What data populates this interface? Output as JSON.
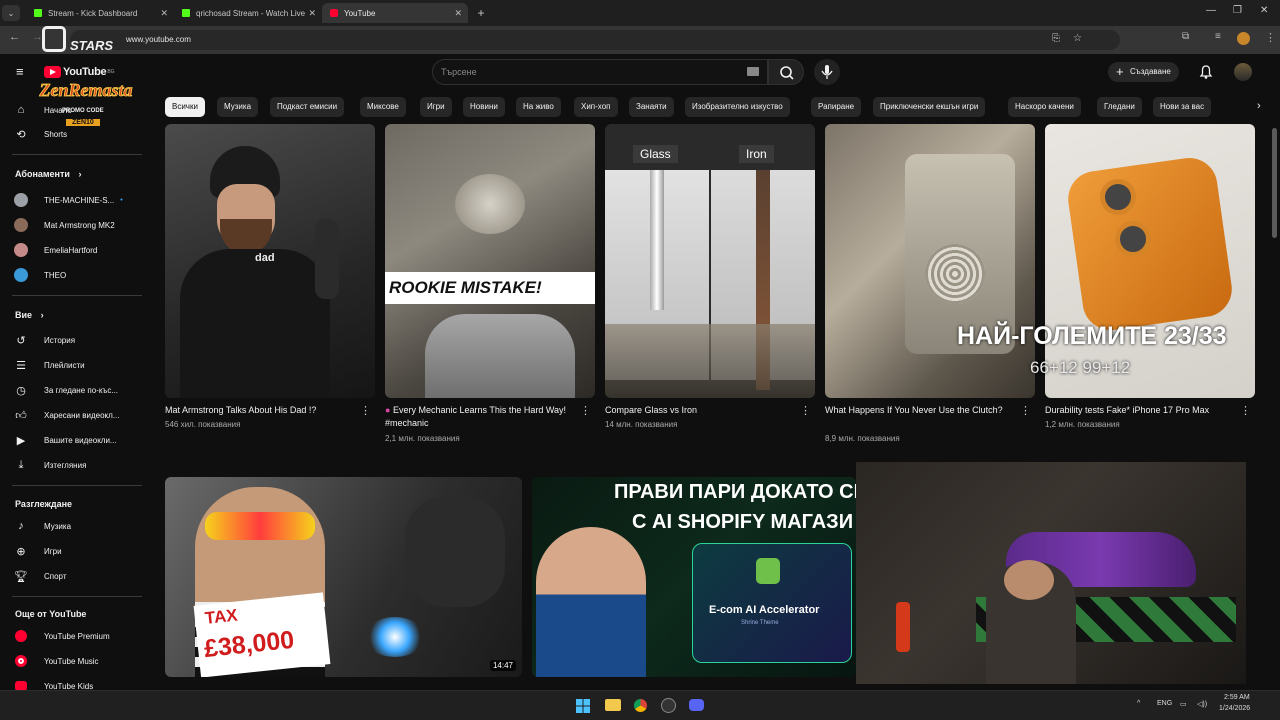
{
  "browser": {
    "tabs": [
      {
        "label": "Stream - Kick Dashboard",
        "icon": "kick-icon"
      },
      {
        "label": "qrichosad Stream - Watch Live",
        "icon": "kick-icon"
      },
      {
        "label": "YouTube",
        "icon": "youtube-icon"
      }
    ],
    "url": "www.youtube.com"
  },
  "overlay": {
    "stars": "STARS",
    "promo_label": "PROMO CODE",
    "promo_code": "ZEN10"
  },
  "header": {
    "logo_text": "YouTube",
    "logo_region": "BG",
    "search_placeholder": "Търсене",
    "create_label": "Създаване"
  },
  "sidebar": {
    "top": [
      {
        "label": "Начало",
        "icon": "home-icon"
      },
      {
        "label": "Shorts",
        "icon": "shorts-icon"
      }
    ],
    "subs_heading": "Абонаменти",
    "subs": [
      {
        "label": "THE-MACHINE-S...",
        "color": "#9aa0a6"
      },
      {
        "label": "Mat Armstrong MK2",
        "color": "#8a6b5a"
      },
      {
        "label": "EmeliaHartford",
        "color": "#c48a8a"
      },
      {
        "label": "THEO",
        "color": "#3a9ad9"
      }
    ],
    "you_heading": "Вие",
    "you": [
      {
        "label": "История",
        "icon": "history-icon"
      },
      {
        "label": "Плейлисти",
        "icon": "playlist-icon"
      },
      {
        "label": "За гледане по-къс...",
        "icon": "clock-icon"
      },
      {
        "label": "Харесани видеокл...",
        "icon": "like-icon"
      },
      {
        "label": "Вашите видеокли...",
        "icon": "video-icon"
      },
      {
        "label": "Изтегляния",
        "icon": "download-icon"
      }
    ],
    "explore_heading": "Разглеждане",
    "explore": [
      {
        "label": "Музика",
        "icon": "music-icon"
      },
      {
        "label": "Игри",
        "icon": "gamepad-icon"
      },
      {
        "label": "Спорт",
        "icon": "trophy-icon"
      }
    ],
    "more_heading": "Още от YouTube",
    "more": [
      {
        "label": "YouTube Premium"
      },
      {
        "label": "YouTube Music"
      },
      {
        "label": "YouTube Kids"
      }
    ]
  },
  "chips": [
    "Всички",
    "Музика",
    "Подкаст емисии",
    "Миксове",
    "Игри",
    "Новини",
    "На живо",
    "Хип-хоп",
    "Занаяти",
    "Изобразително изкуство",
    "Рапиране",
    "Приключенски екшън игри",
    "Наскоро качени",
    "Гледани",
    "Нови за вас"
  ],
  "videos_row1": [
    {
      "title": "Mat Armstrong Talks About His Dad !?",
      "meta": "546 хил. показвания"
    },
    {
      "title": "Every Mechanic Learns This the Hard Way! #mechanic",
      "meta": "2,1 млн. показвания",
      "overlay": "ROOKIE MISTAKE!"
    },
    {
      "title": "Compare Glass vs Iron",
      "meta": "14 млн. показвания",
      "label_left": "Glass",
      "label_right": "Iron"
    },
    {
      "title": "What Happens If You Never Use the Clutch?",
      "meta": "8,9 млн. показвания"
    },
    {
      "title": "Durability tests Fake* iPhone 17 Pro Max",
      "meta": "1,2 млн. показвания"
    }
  ],
  "shirt_text": "dad",
  "stream_overlay": {
    "line1": "НАЙ-ГОЛЕМИТЕ 23/33",
    "line2": "66+12 99+12"
  },
  "videos_row2": [
    {
      "duration": "14:47",
      "tax_label": "TAX",
      "tax_amount": "£38,000"
    },
    {
      "banner_line1": "ПРАВИ ПАРИ ДОКАТО СПИ",
      "banner_line2": "С AI SHOPIFY МАГАЗИ",
      "card_title": "E-com AI Accelerator",
      "card_sub": "Shrine Theme"
    }
  ],
  "taskbar": {
    "lang": "ENG",
    "time": "2:59 AM",
    "date": "1/24/2026"
  }
}
